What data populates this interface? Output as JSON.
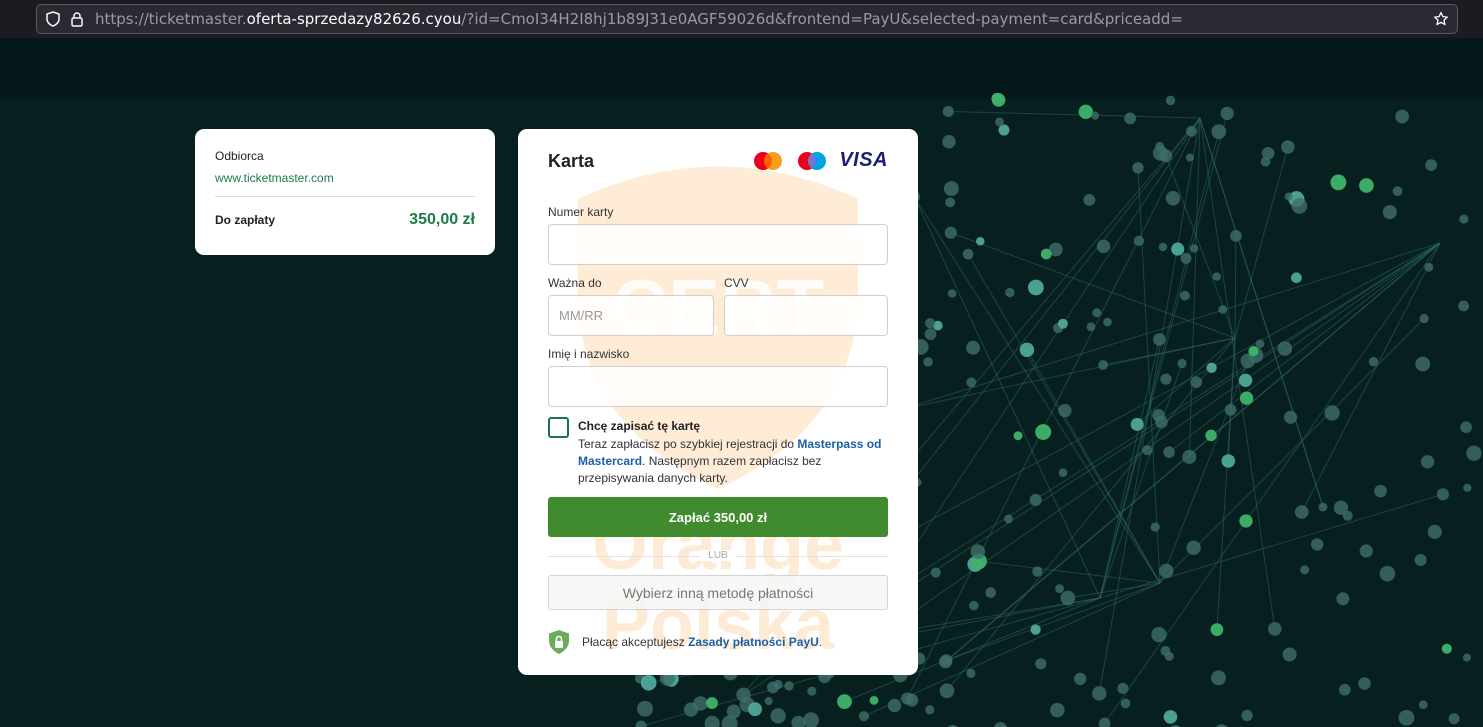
{
  "browser": {
    "url_prefix": "https://ticketmaster.",
    "url_domain": "oferta-sprzedazy82626.cyou",
    "url_rest": "/?id=CmoI34H2I8hj1b89J31e0AGF59026d&frontend=PayU&selected-payment=card&priceadd="
  },
  "summary": {
    "recipient_label": "Odbiorca",
    "recipient_site": "www.ticketmaster.com",
    "due_label": "Do zapłaty",
    "amount": "350,00 zł"
  },
  "payment": {
    "title": "Karta",
    "brands": [
      "mastercard-icon",
      "maestro-icon",
      "VISA"
    ],
    "card_number_label": "Numer karty",
    "card_number_value": "",
    "expiry_label": "Ważna do",
    "expiry_placeholder": "MM/RR",
    "cvv_label": "CVV",
    "cvv_value": "",
    "name_label": "Imię i nazwisko",
    "name_value": "",
    "save_title": "Chcę zapisać tę kartę",
    "save_desc_1": "Teraz zapłacisz po szybkiej rejestracji do ",
    "save_desc_link": "Masterpass od Mastercard",
    "save_desc_2": ". Następnym razem zapłacisz bez przepisywania danych karty.",
    "pay_button": "Zapłać 350,00 zł",
    "or_text": "LUB",
    "alt_method_button": "Wybierz inną metodę płatności",
    "terms_text": "Płacąc akceptujesz ",
    "terms_link": "Zasady płatności PayU",
    "terms_end": "."
  },
  "watermark": {
    "top_text": "CERT",
    "bottom_line1": "Orange",
    "bottom_line2": "Polska"
  },
  "colors": {
    "accent_green": "#3f8b2e",
    "amount_green": "#1f7a4a",
    "link_blue": "#1b5fa8",
    "background": "#07201f"
  }
}
